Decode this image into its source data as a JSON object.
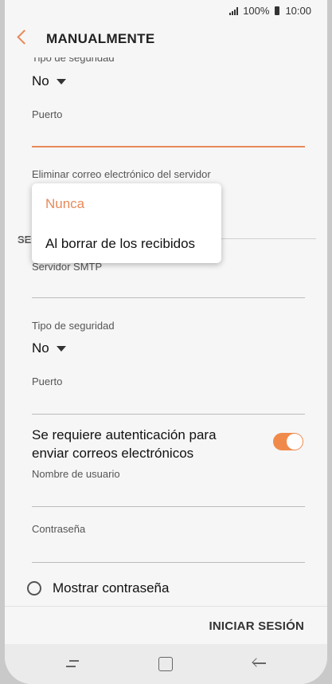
{
  "status": {
    "signal_icon": "signal-bars-icon",
    "battery_percent": "100%",
    "battery_icon": "battery-icon",
    "time": "10:00"
  },
  "header": {
    "title": "MANUALMENTE",
    "back_icon": "back-arrow-icon"
  },
  "incoming": {
    "security_label": "Tipo de seguridad",
    "security_value": "No",
    "port_label": "Puerto",
    "delete_label": "Eliminar correo electrónico del servidor"
  },
  "dropdown": {
    "options": [
      "Nunca",
      "Al borrar de los recibidos"
    ],
    "selected": "Nunca"
  },
  "outgoing": {
    "section_label": "SE",
    "smtp_label": "Servidor SMTP",
    "security_label": "Tipo de seguridad",
    "security_value": "No",
    "port_label": "Puerto",
    "auth_label": "Se requiere autenticación para enviar correos electrónicos",
    "auth_enabled": true,
    "username_label": "Nombre de usuario",
    "password_label": "Contraseña"
  },
  "show_password_label": "Mostrar contraseña",
  "footer": {
    "login_label": "INICIAR SESIÓN"
  },
  "colors": {
    "accent": "#e8895a",
    "toggle": "#f08a4b"
  }
}
